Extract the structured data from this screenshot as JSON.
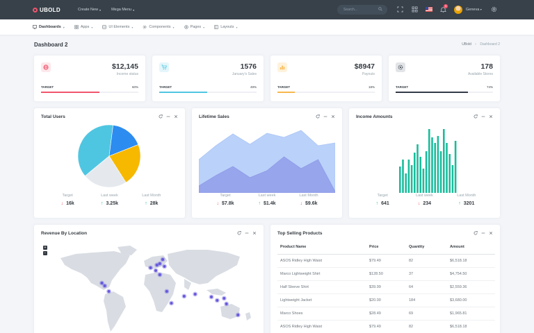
{
  "topbar": {
    "brand": "UBOLD",
    "menus": [
      {
        "label": "Create New"
      },
      {
        "label": "Mega Menu"
      }
    ],
    "search_placeholder": "Search...",
    "notification_count": "9",
    "user_name": "Geneva"
  },
  "nav": [
    {
      "label": "Dashboards",
      "icon": "monitor-icon"
    },
    {
      "label": "Apps",
      "icon": "grid-icon"
    },
    {
      "label": "UI Elements",
      "icon": "layers-icon"
    },
    {
      "label": "Components",
      "icon": "settings-icon"
    },
    {
      "label": "Pages",
      "icon": "file-icon"
    },
    {
      "label": "Layouts",
      "icon": "layout-icon"
    }
  ],
  "page": {
    "title": "Dashboard 2",
    "breadcrumb": [
      "UBold",
      "Dashboard 2"
    ]
  },
  "stats": [
    {
      "value": "$12,145",
      "label": "Income status",
      "target": "TARGET",
      "pct": "60%",
      "progress": 0.6,
      "color": "#f1556c",
      "bg": "#fde8eb",
      "icon": "globe-icon"
    },
    {
      "value": "1576",
      "label": "January's Sales",
      "target": "TARGET",
      "pct": "49%",
      "progress": 0.49,
      "color": "#4fc6e1",
      "bg": "#e4f6fb",
      "icon": "cart-icon"
    },
    {
      "value": "$8947",
      "label": "Payouts",
      "target": "TARGET",
      "pct": "18%",
      "progress": 0.18,
      "color": "#f7b84b",
      "bg": "#fef2dd",
      "icon": "chart-icon"
    },
    {
      "value": "178",
      "label": "Available Stores",
      "target": "TARGET",
      "pct": "74%",
      "progress": 0.74,
      "color": "#323a46",
      "bg": "#e2e4e7",
      "icon": "store-icon"
    }
  ],
  "cards": {
    "total_users": {
      "title": "Total Users",
      "kpis": [
        {
          "label": "Target",
          "value": "16k",
          "dir": "down"
        },
        {
          "label": "Last week",
          "value": "3.25k",
          "dir": "up"
        },
        {
          "label": "Last Month",
          "value": "28k",
          "dir": "up"
        }
      ]
    },
    "lifetime_sales": {
      "title": "Lifetime Sales",
      "kpis": [
        {
          "label": "Target",
          "value": "$7.8k",
          "dir": "down"
        },
        {
          "label": "Last week",
          "value": "$1.4k",
          "dir": "up"
        },
        {
          "label": "Last Month",
          "value": "$9.6k",
          "dir": "down"
        }
      ]
    },
    "income_amounts": {
      "title": "Income Amounts",
      "kpis": [
        {
          "label": "Target",
          "value": "641",
          "dir": "up"
        },
        {
          "label": "Last week",
          "value": "234",
          "dir": "down"
        },
        {
          "label": "Last Month",
          "value": "3201",
          "dir": "up"
        }
      ]
    },
    "revenue": {
      "title": "Revenue By Location",
      "zoom_in": "+",
      "zoom_out": "−"
    },
    "top_products": {
      "title": "Top Selling Products",
      "columns": [
        "Product Name",
        "Price",
        "Quantity",
        "Amount"
      ],
      "rows": [
        [
          "ASOS Ridley High Waist",
          "$79.49",
          "82",
          "$6,518.18"
        ],
        [
          "Marco Lightweight Shirt",
          "$128.50",
          "37",
          "$4,754.50"
        ],
        [
          "Half Sleeve Shirt",
          "$39.99",
          "64",
          "$2,559.36"
        ],
        [
          "Lightweight Jacket",
          "$20.00",
          "184",
          "$3,680.00"
        ],
        [
          "Marco Shoes",
          "$28.49",
          "69",
          "$1,965.81"
        ],
        [
          "ASOS Ridley High Waist",
          "$79.49",
          "82",
          "$6,518.18"
        ]
      ]
    }
  },
  "chart_data": [
    {
      "type": "pie",
      "title": "Total Users",
      "values": [
        38,
        17,
        22,
        23
      ],
      "colors": [
        "#4fc6e1",
        "#2d8cf0",
        "#f7b800",
        "#e5e9ee"
      ]
    },
    {
      "type": "area",
      "title": "Lifetime Sales",
      "x": [
        0,
        1,
        2,
        3,
        4,
        5,
        6,
        7,
        8
      ],
      "series": [
        {
          "values": [
            48,
            68,
            85,
            70,
            86,
            80,
            90,
            68,
            72
          ],
          "color": "#a9c5f7"
        },
        {
          "values": [
            10,
            25,
            38,
            22,
            32,
            52,
            35,
            48,
            2
          ],
          "color": "#8f9ae8"
        }
      ],
      "ylim": [
        0,
        100
      ]
    },
    {
      "type": "bar",
      "title": "Income Amounts",
      "values": [
        38,
        48,
        28,
        48,
        40,
        58,
        70,
        52,
        35,
        60,
        92,
        80,
        72,
        82,
        60,
        92,
        72,
        56,
        40,
        75
      ],
      "color": "#1abc9c",
      "ylim": [
        0,
        100
      ]
    }
  ],
  "map": {
    "land_color": "#d9dde3",
    "marker_color": "#6658dd",
    "markers": [
      [
        -87,
        24
      ],
      [
        -82,
        20
      ],
      [
        -75,
        12
      ],
      [
        -3,
        46
      ],
      [
        8,
        50
      ],
      [
        13,
        52
      ],
      [
        21,
        48
      ],
      [
        18,
        58
      ],
      [
        6,
        42
      ],
      [
        13,
        36
      ],
      [
        25,
        12
      ],
      [
        55,
        5
      ],
      [
        74,
        8
      ],
      [
        102,
        4
      ],
      [
        112,
        -1
      ],
      [
        124,
        2
      ],
      [
        128,
        -6
      ],
      [
        33,
        -5
      ],
      [
        148,
        -22
      ]
    ]
  }
}
